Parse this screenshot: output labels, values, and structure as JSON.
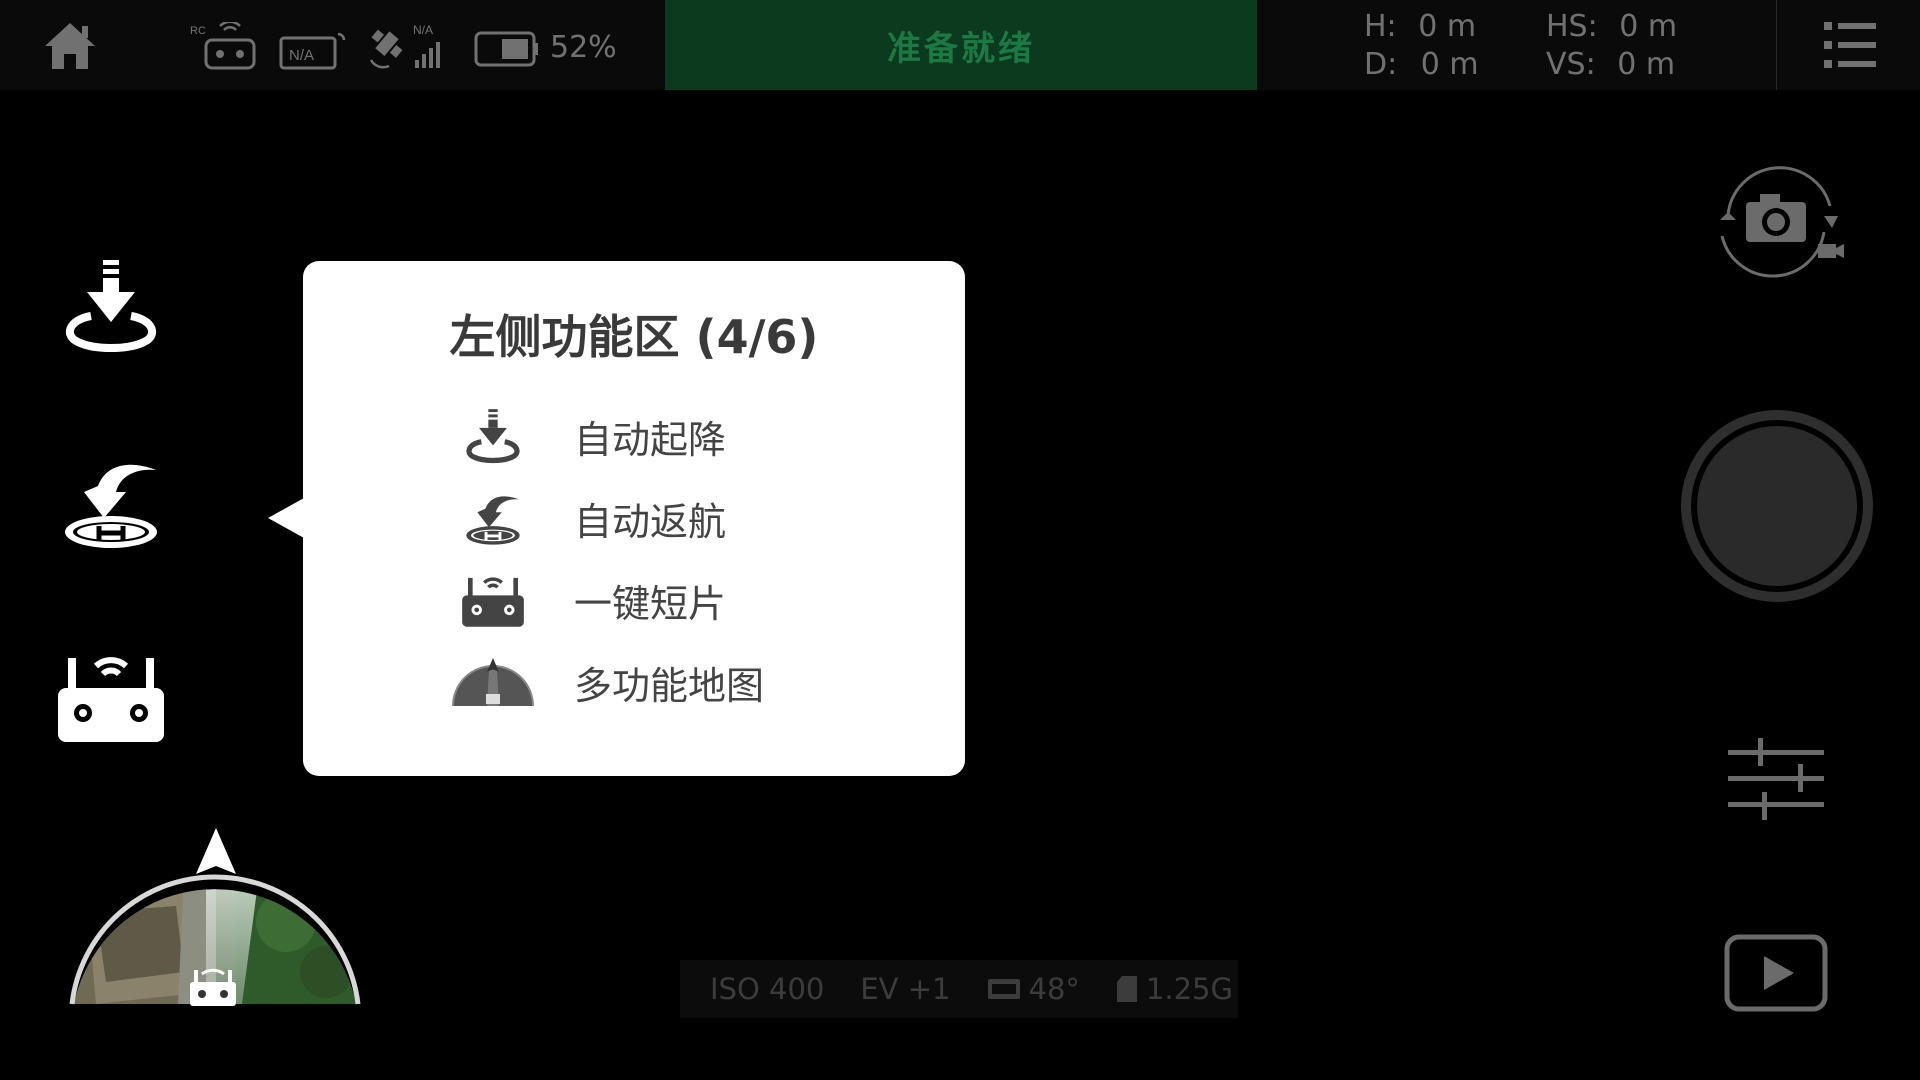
{
  "topbar": {
    "home_icon": "home-icon",
    "rc_label": "RC",
    "hd_label": "N/A",
    "gps_label": "N/A",
    "battery_percent": "52%",
    "status": "准备就绪",
    "telemetry": {
      "h_label": "H:",
      "h_value": "0 m",
      "d_label": "D:",
      "d_value": "0 m",
      "hs_label": "HS:",
      "hs_value": "0 m",
      "vs_label": "VS:",
      "vs_value": "0 m"
    }
  },
  "tutorial": {
    "title": "左侧功能区 (4/6)",
    "items": [
      {
        "icon": "auto-takeoff-icon",
        "label": "自动起降"
      },
      {
        "icon": "return-home-icon",
        "label": "自动返航"
      },
      {
        "icon": "remote-controller-icon",
        "label": "一键短片"
      },
      {
        "icon": "map-radar-icon",
        "label": "多功能地图"
      }
    ]
  },
  "camera_info": {
    "iso": "ISO 400",
    "ev": "EV +1",
    "temp": "48°",
    "storage": "1.25G"
  },
  "colors": {
    "status_bg": "#0b3a1f",
    "status_text": "#1b7a44",
    "popup_bg": "#ffffff"
  }
}
